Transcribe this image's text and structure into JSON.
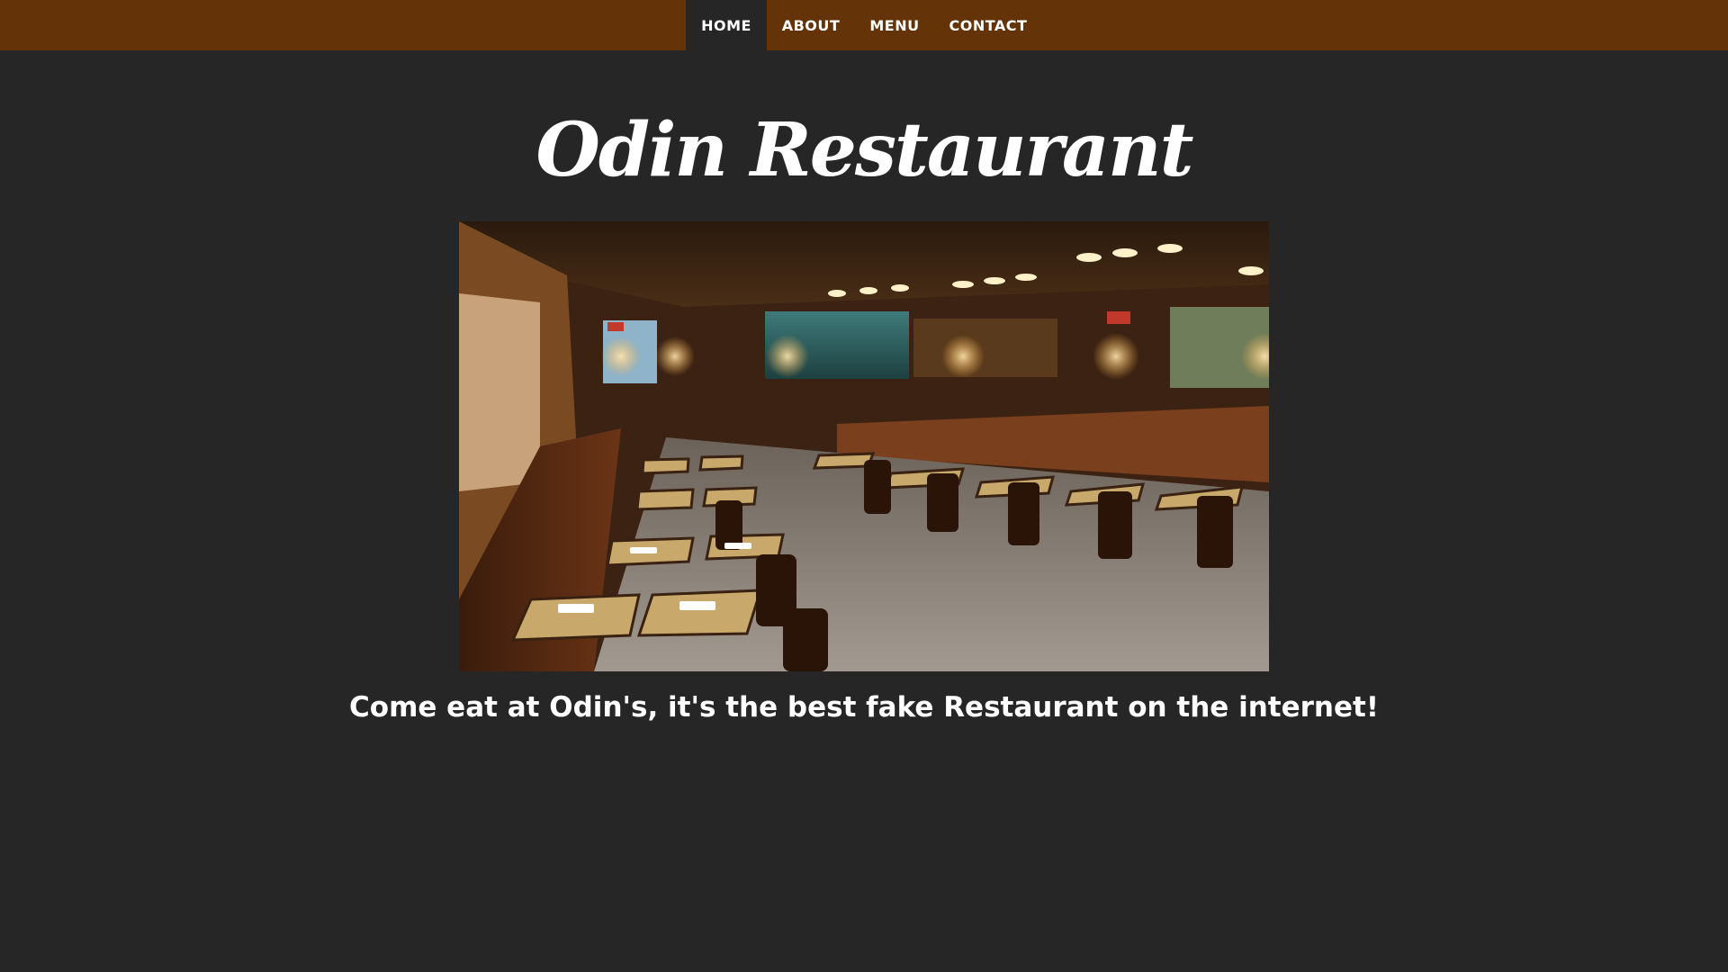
{
  "nav": {
    "items": [
      {
        "label": "HOME",
        "active": true
      },
      {
        "label": "ABOUT",
        "active": false
      },
      {
        "label": "MENU",
        "active": false
      },
      {
        "label": "CONTACT",
        "active": false
      }
    ]
  },
  "hero": {
    "title": "Odin Restaurant",
    "tagline": "Come eat at Odin's, it's the best fake Restaurant on the internet!"
  },
  "colors": {
    "navbar_bg": "#643408",
    "page_bg": "#262626",
    "text": "#ffffff"
  }
}
